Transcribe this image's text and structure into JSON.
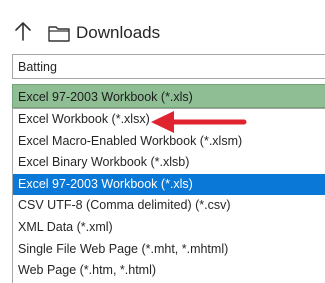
{
  "navigation": {
    "up_icon": "up-arrow-icon",
    "folder_icon": "folder-icon",
    "folder_name": "Downloads"
  },
  "file_name": {
    "value": "Batting"
  },
  "file_type": {
    "selected": "Excel 97-2003 Workbook (*.xls)"
  },
  "dropdown": {
    "options": [
      {
        "label": "Excel Workbook (*.xlsx)",
        "highlighted": false
      },
      {
        "label": "Excel Macro-Enabled Workbook (*.xlsm)",
        "highlighted": false
      },
      {
        "label": "Excel Binary Workbook (*.xlsb)",
        "highlighted": false
      },
      {
        "label": "Excel 97-2003 Workbook (*.xls)",
        "highlighted": true
      },
      {
        "label": "CSV UTF-8 (Comma delimited) (*.csv)",
        "highlighted": false
      },
      {
        "label": "XML Data (*.xml)",
        "highlighted": false
      },
      {
        "label": "Single File Web Page (*.mht, *.mhtml)",
        "highlighted": false
      },
      {
        "label": "Web Page (*.htm, *.html)",
        "highlighted": false
      }
    ]
  },
  "annotation": {
    "arrow_color": "#e0242f",
    "points_to": "Excel Workbook (*.xlsx)"
  },
  "colors": {
    "selected_type_bg": "#8fbe94",
    "highlight_bg": "#0a78d7",
    "highlight_text": "#ffffff"
  }
}
